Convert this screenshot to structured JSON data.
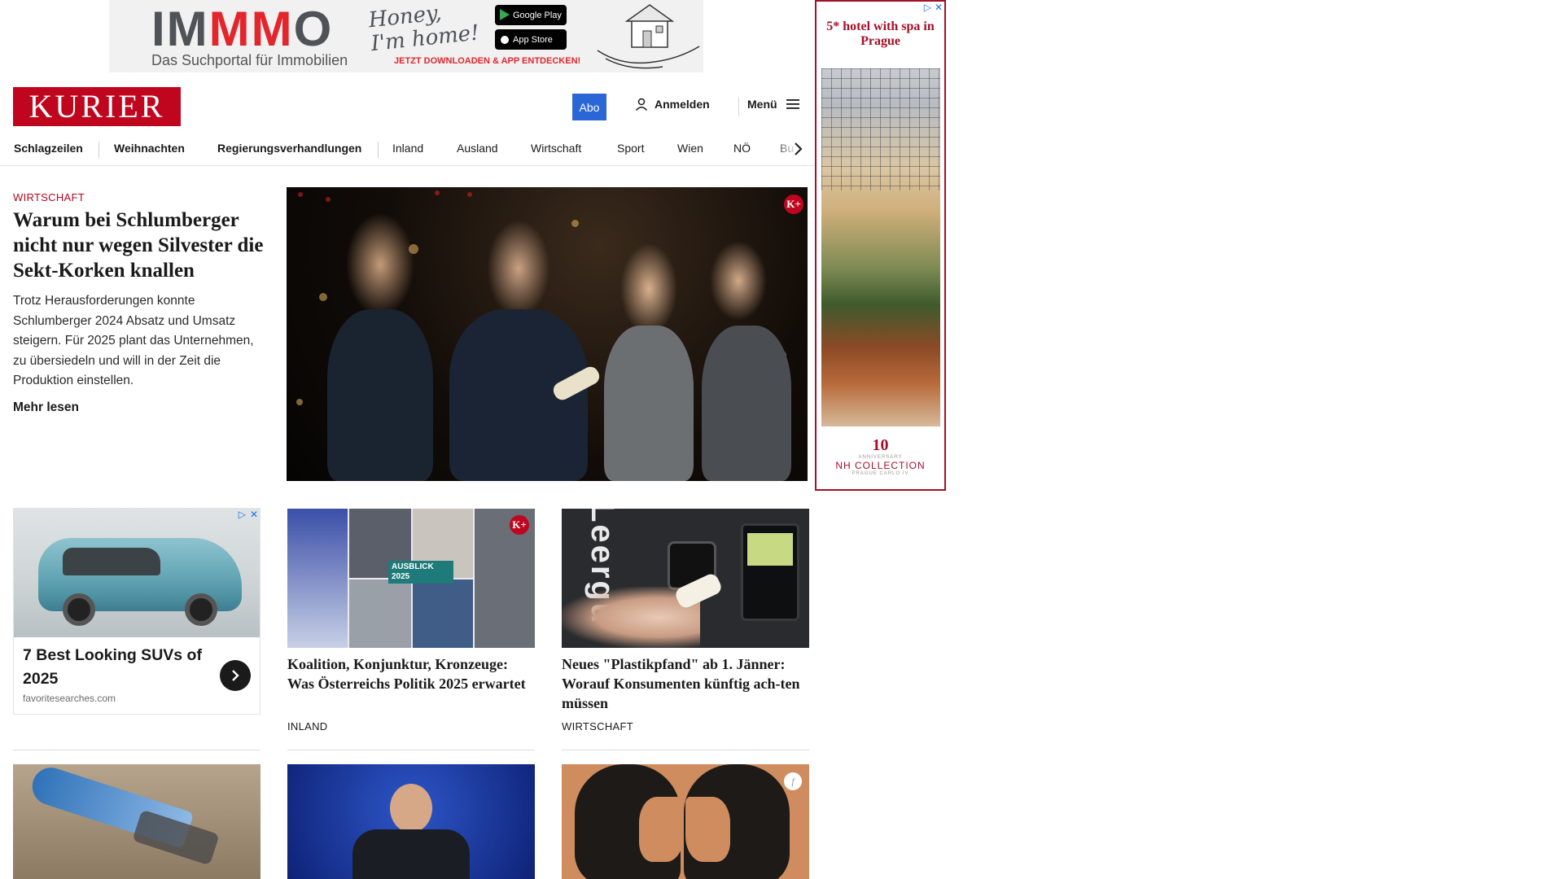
{
  "top_ad": {
    "brand_left": "IM",
    "brand_mid": "MM",
    "brand_right": "O",
    "tagline": "Das Suchportal für Immobilien",
    "script": "Honey, I'm home!",
    "google_play": "Google Play",
    "app_store": "App Store",
    "cta": "JETZT DOWNLOADEN & APP ENTDECKEN!"
  },
  "side_ad": {
    "headline": "5* hotel with spa in Prague",
    "logo_number": "10",
    "logo_anniversary": "ANNIVERSARY",
    "logo_name": "NH COLLECTION",
    "logo_sub": "PRAGUE CARLO IV"
  },
  "header": {
    "logo": "KURIER",
    "abo": "Abo",
    "login": "Anmelden",
    "menu": "Menü"
  },
  "nav": {
    "items": [
      "Schlagzeilen",
      "Weihnachten",
      "Regierungsverhandlungen",
      "Inland",
      "Ausland",
      "Wirtschaft",
      "Sport",
      "Wien",
      "NÖ",
      "Bu"
    ]
  },
  "lead": {
    "category": "WIRTSCHAFT",
    "title": "Warum bei Schlumberger nicht nur wegen Silvester die Sekt-Korken knallen",
    "teaser": "Trotz Herausforderungen konnte Schlumberger 2024 Absatz und Umsatz steigern. Für 2025 plant das Unternehmen, zu übersiedeln und will in der Zeit die Produktion einstellen.",
    "more": "Mehr lesen",
    "badge": "K+"
  },
  "sponsored": {
    "title": "7 Best Looking SUVs of 2025",
    "source": "favoritesearches.com"
  },
  "cards": [
    {
      "title": "Koalition, Konjunktur, Kronzeuge: Was Österreichs Politik 2025 erwartet",
      "category": "INLAND",
      "badge": "K+",
      "overlay": "AUSBLICK 2025"
    },
    {
      "title": "Neues \"Plastikpfand\" ab 1. Jänner: Worauf Konsumenten künftig ach-ten müssen",
      "category": "WIRTSCHAFT",
      "machine_text": "Leergu"
    }
  ],
  "colors": {
    "brand_red": "#c0061e",
    "abo_blue": "#2b66d6"
  }
}
